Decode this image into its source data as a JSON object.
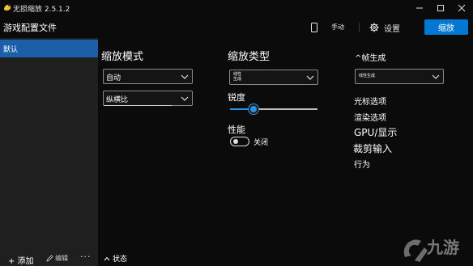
{
  "window": {
    "title": "无损缩放 2.5.1.2"
  },
  "header": {
    "title": "游戏配置文件",
    "manual_label": "手动",
    "settings_label": "设置",
    "scale_button": "缩放"
  },
  "sidebar": {
    "profiles": [
      "默认"
    ],
    "add_label": "+ 添加",
    "edit_label": "编辑",
    "more_label": "···"
  },
  "scaling_mode": {
    "title": "缩放模式",
    "mode_value": "自动",
    "aspect_value": "纵横比"
  },
  "scaling_type": {
    "title": "缩放类型",
    "type_value": "线性生成",
    "sharpness_label": "锐度",
    "sharpness_value": 0.2,
    "performance_label": "性能",
    "performance_toggle": "关闭"
  },
  "frame_gen": {
    "title": "^帧生成",
    "type_value": "线性生成",
    "cursor_options": "光标选项",
    "render_options": "渲染选项",
    "gpu_display": "GPU/显示",
    "crop_input": "裁剪输入",
    "behavior": "行为"
  },
  "status": {
    "label": "状态"
  },
  "watermark": {
    "text": "九游"
  },
  "colors": {
    "accent": "#0078d4",
    "selected": "#1a5fa8",
    "sidebar": "#1f1f1f",
    "background": "#0b0b0b"
  }
}
